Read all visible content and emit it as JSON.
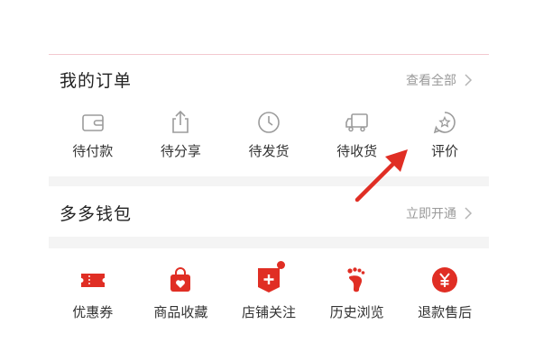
{
  "orders": {
    "title": "我的订单",
    "view_all": "查看全部",
    "items": [
      {
        "label": "待付款",
        "icon": "wallet-icon"
      },
      {
        "label": "待分享",
        "icon": "share-icon"
      },
      {
        "label": "待发货",
        "icon": "clock-icon"
      },
      {
        "label": "待收货",
        "icon": "truck-icon"
      },
      {
        "label": "评价",
        "icon": "star-comment-icon"
      }
    ]
  },
  "wallet": {
    "title": "多多钱包",
    "action": "立即开通"
  },
  "services": {
    "items": [
      {
        "label": "优惠券",
        "icon": "coupon-icon"
      },
      {
        "label": "商品收藏",
        "icon": "bag-heart-icon"
      },
      {
        "label": "店铺关注",
        "icon": "shop-follow-icon",
        "badge": true
      },
      {
        "label": "历史浏览",
        "icon": "footprint-icon"
      },
      {
        "label": "退款售后",
        "icon": "refund-yen-icon"
      }
    ]
  },
  "colors": {
    "accent": "#e02e24",
    "icon_gray": "#9b9b9b",
    "muted_text": "#9a9a9a"
  }
}
